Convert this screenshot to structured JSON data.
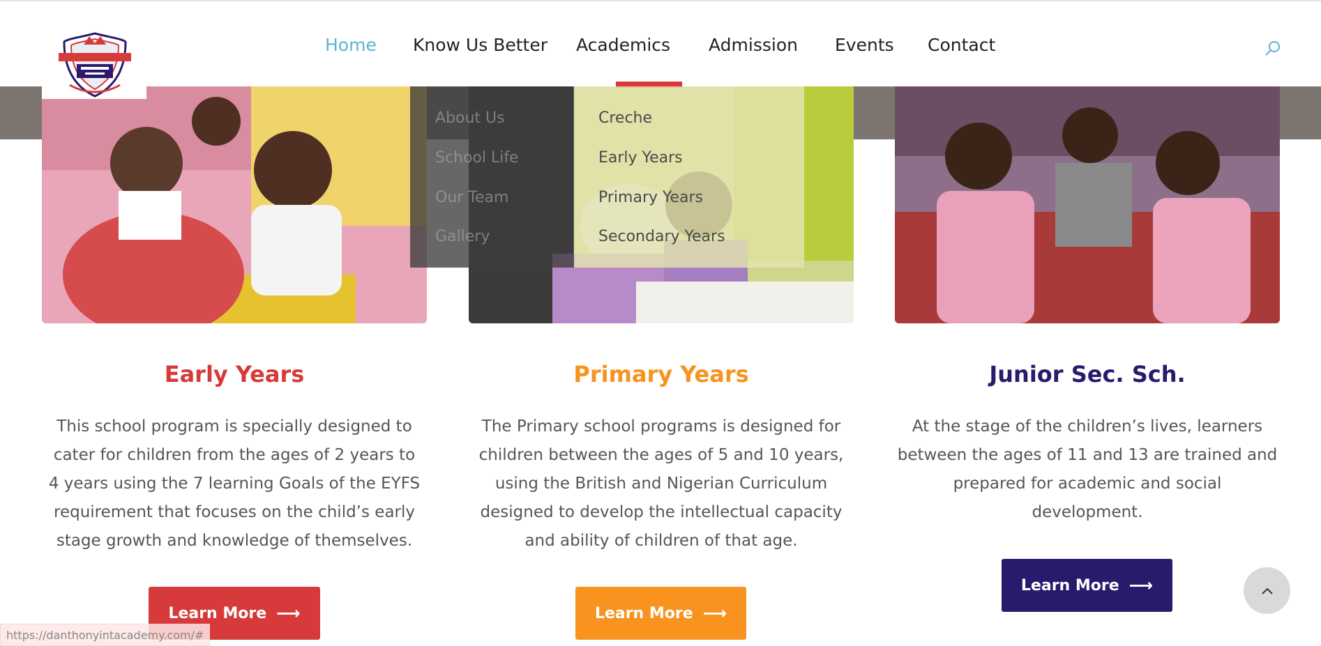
{
  "nav": {
    "items": [
      {
        "label": "Home",
        "active": true
      },
      {
        "label": "Know Us Better"
      },
      {
        "label": "Academics"
      },
      {
        "label": "Admission"
      },
      {
        "label": "Events"
      },
      {
        "label": "Contact"
      }
    ],
    "search_icon": "search-icon"
  },
  "dropdown": {
    "know_us": [
      "About Us",
      "School Life",
      "Our Team",
      "Gallery"
    ],
    "academics": [
      "Creche",
      "Early Years",
      "Primary Years",
      "Secondary Years"
    ]
  },
  "cards": [
    {
      "title": "Early Years",
      "color": "#d63a3a",
      "lines": [
        "This school program is specially designed to",
        "cater for children from the ages of 2 years to",
        "4 years using the 7 learning Goals of the EYFS",
        "requirement that focuses on the child’s early",
        "stage growth and knowledge of themselves."
      ],
      "button": "Learn More"
    },
    {
      "title": "Primary Years",
      "color": "#f7931e",
      "lines": [
        "The Primary school programs is designed for",
        "children between the ages of 5 and 10 years,",
        "using the British and Nigerian Curriculum",
        "designed to develop the intellectual capacity",
        "and ability of children of that age."
      ],
      "button": "Learn More"
    },
    {
      "title": "Junior Sec. Sch.",
      "color": "#2a1a6e",
      "lines": [
        "At the stage of the children’s lives, learners",
        "between the ages of 11 and 13 are trained and",
        "prepared for academic and social",
        "development."
      ],
      "button": "Learn More"
    }
  ],
  "status_url": "https://danthonyintacademy.com/#",
  "colors": {
    "accent": "#5ab4d6",
    "red": "#d63a3a",
    "orange": "#f7931e",
    "navy": "#2a1a6e"
  }
}
